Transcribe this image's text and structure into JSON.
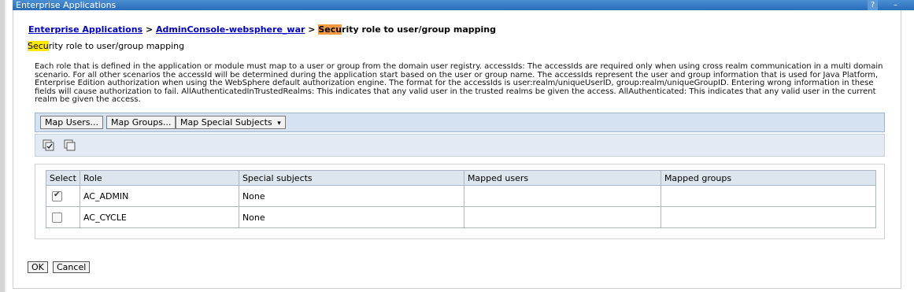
{
  "window": {
    "title": "Enterprise Applications",
    "help_label": "?",
    "minimize_label": "–"
  },
  "breadcrumb": {
    "item1": "Enterprise Applications",
    "sep1": " > ",
    "item2": "AdminConsole-websphere_war",
    "sep2": " > ",
    "current_highlight": "Secu",
    "current_rest": "rity role to user/group mapping"
  },
  "subtitle": {
    "highlight": "Secu",
    "rest": "rity role to user/group mapping"
  },
  "description": "Each role that is defined in the application or module must map to a user or group from the domain user registry. accessIds: The accessIds are required only when using cross realm communication in a multi domain scenario. For all other scenarios the accessId will be determined during the application start based on the user or group name. The accessIds represent the user and group information that is used for Java Platform, Enterprise Edition authorization when using the WebSphere default authorization engine. The format for the accessIds is user:realm/uniqueUserID, group:realm/uniqueGroupID. Entering wrong information in these fields will cause authorization to fail. AllAuthenticatedInTrustedRealms: This indicates that any valid user in the trusted realms be given the access. AllAuthenticated: This indicates that any valid user in the current realm be given the access.",
  "toolbar": {
    "map_users": "Map Users...",
    "map_groups": "Map Groups...",
    "map_special": "Map Special Subjects",
    "dropdown_arrow": "▾"
  },
  "icons": {
    "select_all": "select-all-icon",
    "deselect_all": "deselect-all-icon"
  },
  "table": {
    "headers": [
      "Select",
      "Role",
      "Special subjects",
      "Mapped users",
      "Mapped groups"
    ],
    "rows": [
      {
        "checked": true,
        "role": "AC_ADMIN",
        "special": "None",
        "users": "",
        "groups": ""
      },
      {
        "checked": false,
        "role": "AC_CYCLE",
        "special": "None",
        "users": "",
        "groups": ""
      }
    ]
  },
  "actions": {
    "ok": "OK",
    "cancel": "Cancel"
  },
  "colors": {
    "title_bar": "#2a6cb8",
    "link": "#0000c8",
    "highlight_orange": "#f29a43",
    "highlight_yellow": "#ffe800",
    "toolbar_bg": "#d5e2f2"
  }
}
